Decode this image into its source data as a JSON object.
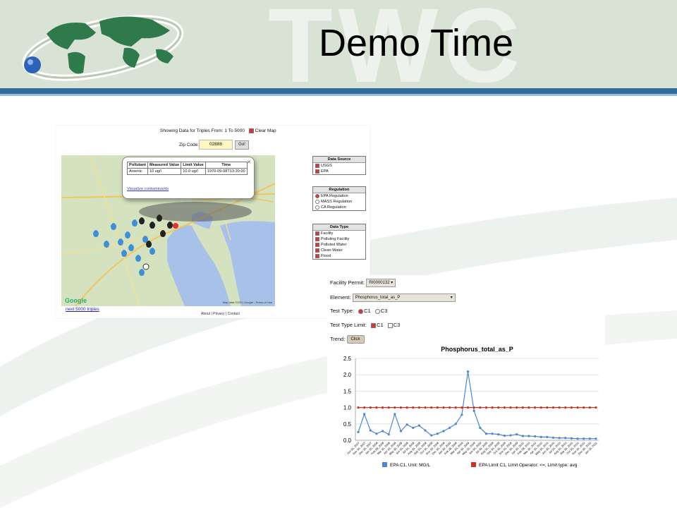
{
  "slide": {
    "title": "Demo Time",
    "watermark": "TWC",
    "colors": {
      "header_bg": "#d8e3d6",
      "band": "#2f6e9a"
    }
  },
  "map_app": {
    "showing_text": "Showing Data for Triples From: 1 To 5000",
    "clear_map_label": "Clear Map",
    "zip_label": "Zip Code:",
    "zip_value": "02888",
    "go_label": "Go!",
    "popup": {
      "headers": [
        "Pollutant",
        "Measured Value",
        "Limit Value",
        "Time"
      ],
      "row": [
        "Arsenic",
        "10 ug/l",
        "10.0 ug/l",
        "1970-09-08T13:20:00"
      ],
      "visualize_link": "Visualize contaminants"
    },
    "next_link": "next 5000 triples",
    "footer": "About | Privacy | Contact",
    "google_logo": "Google",
    "map_data": "Map data ©2011 Google - Terms of Use",
    "data_source": {
      "title": "Data Source",
      "items": [
        "USGS",
        "EPA"
      ]
    },
    "regulation": {
      "title": "Regulation",
      "items": [
        "EPA Regulation",
        "MASS Regulation",
        "CA Regulation"
      ],
      "selected": "EPA Regulation"
    },
    "data_type": {
      "title": "Data Type",
      "items": [
        "Facility",
        "Polluting Facility",
        "Polluted Water",
        "Clean Water",
        "Flood"
      ]
    }
  },
  "chart_app": {
    "facility_label": "Facility Permit:",
    "facility_value": "RI0000132",
    "element_label": "Element:",
    "element_value": "Phosphorus_total_as_P",
    "test_type_label": "Test Type:",
    "test_type_options": [
      "C1",
      "C3"
    ],
    "test_type_selected": "C1",
    "test_type_limit_label": "Test Type Limit:",
    "test_type_limit_options": [
      "C1",
      "C3"
    ],
    "trend_label": "Trend:",
    "trend_button": "Click"
  },
  "chart_data": {
    "type": "line",
    "title": "Phosphorus_total_as_P",
    "xlabel": "",
    "ylabel": "",
    "ylim": [
      0,
      2.5
    ],
    "yticks": [
      "0.0",
      "0.5",
      "1.0",
      "1.5",
      "2.0",
      "2.5"
    ],
    "grid": true,
    "legend_position": "bottom",
    "x": [
      "Oct 30, 2007",
      "Nov 30, 2007",
      "Dec 30, 2007",
      "Jan 30, 2008",
      "Feb 28, 2008",
      "Mar 30, 2008",
      "Apr 30, 2008",
      "May 30, 2008",
      "Jun 30, 2008",
      "Jul 30, 2008",
      "Aug 30, 2008",
      "Sep 30, 2008",
      "Oct 30, 2008",
      "Nov 30, 2008",
      "Dec 30, 2008",
      "Jan 30, 2009",
      "Feb 28, 2009",
      "Mar 30, 2009",
      "Apr 30, 2009",
      "May 30, 2009",
      "Jun 30, 2009",
      "Jul 30, 2009",
      "Aug 30, 2009",
      "Sep 30, 2009",
      "Oct 30, 2009",
      "Nov 30, 2009",
      "Dec 30, 2009",
      "Jan 30, 2010",
      "Feb 28, 2010",
      "Mar 30, 2010",
      "Apr 30, 2010",
      "May 30, 2010",
      "Jun 30, 2010",
      "Jul 30, 2010",
      "Aug 30, 2010",
      "Sep 30, 2010",
      "Oct 30, 2010",
      "Nov 30, 2010",
      "Dec 30, 2010",
      "Jan 30, 2011"
    ],
    "series": [
      {
        "name": "EPA C1, Unit: MG/L",
        "color": "#4a86d8",
        "values": [
          0.25,
          0.8,
          0.3,
          0.2,
          0.28,
          0.18,
          0.8,
          0.28,
          0.48,
          0.38,
          0.45,
          0.3,
          0.15,
          0.2,
          0.28,
          0.38,
          0.5,
          0.78,
          2.1,
          0.9,
          0.38,
          0.2,
          0.2,
          0.18,
          0.14,
          0.15,
          0.18,
          0.13,
          0.13,
          0.12,
          0.1,
          0.1,
          0.08,
          0.07,
          0.07,
          0.06,
          0.05,
          0.05,
          0.05,
          0.05
        ]
      },
      {
        "name": "EPA Limit C1, Limit Operator: <=, Limit type: avg",
        "color": "#cc3322",
        "values": [
          1,
          1,
          1,
          1,
          1,
          1,
          1,
          1,
          1,
          1,
          1,
          1,
          1,
          1,
          1,
          1,
          1,
          1,
          1,
          1,
          1,
          1,
          1,
          1,
          1,
          1,
          1,
          1,
          1,
          1,
          1,
          1,
          1,
          1,
          1,
          1,
          1,
          1,
          1,
          1
        ]
      }
    ]
  }
}
